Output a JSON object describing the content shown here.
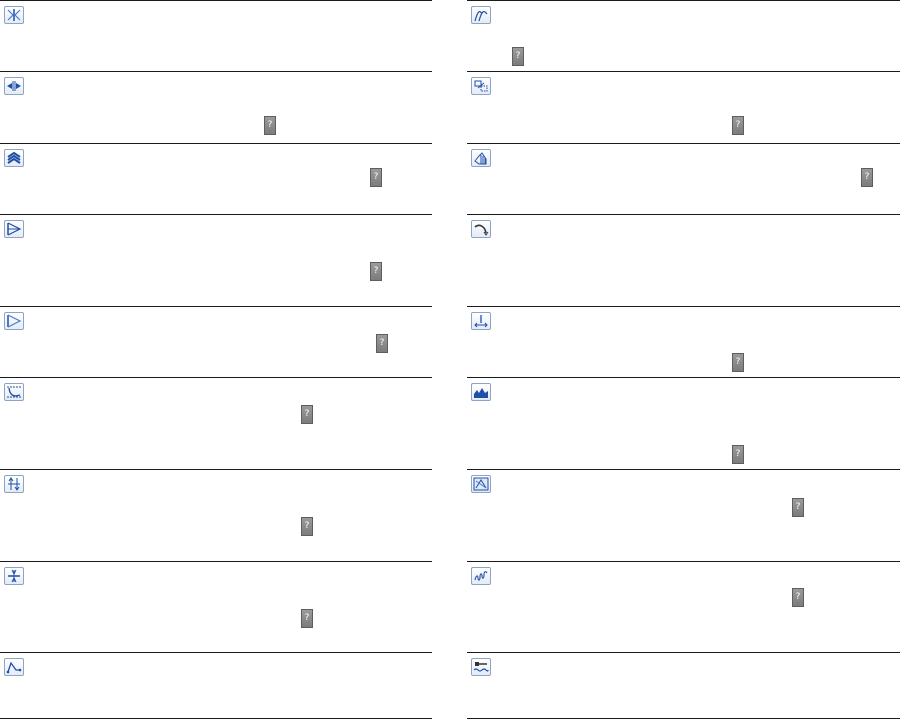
{
  "help_label": "?",
  "colors": {
    "border": "#1a1a1a",
    "icon_blue": "#1f4fa8",
    "icon_frame": "#8fa3c2",
    "help_button": "#8a8a8a"
  },
  "left_column": [
    {
      "icon": "mirror-symmetry-icon",
      "has_help": false
    },
    {
      "icon": "horizontal-spread-icon",
      "has_help": true
    },
    {
      "icon": "layered-chevrons-icon",
      "has_help": true
    },
    {
      "icon": "triangle-cross-icon",
      "has_help": true
    },
    {
      "icon": "triangle-frame-icon",
      "has_help": true
    },
    {
      "icon": "curve-fit-icon",
      "has_help": true
    },
    {
      "icon": "vertical-arrows-icon",
      "has_help": true
    },
    {
      "icon": "compress-arrows-icon",
      "has_help": true
    },
    {
      "icon": "peak-path-icon",
      "has_help": false
    }
  ],
  "right_column": [
    {
      "icon": "double-curve-icon",
      "has_help": true
    },
    {
      "icon": "scale-box-icon",
      "has_help": true
    },
    {
      "icon": "hatched-shape-icon",
      "has_help": true
    },
    {
      "icon": "hook-tool-icon",
      "has_help": false
    },
    {
      "icon": "expand-point-icon",
      "has_help": true
    },
    {
      "icon": "mountain-fill-icon",
      "has_help": true
    },
    {
      "icon": "framed-diagram-icon",
      "has_help": true
    },
    {
      "icon": "coil-spring-icon",
      "has_help": true
    },
    {
      "icon": "wave-gauge-icon",
      "has_help": false
    }
  ]
}
